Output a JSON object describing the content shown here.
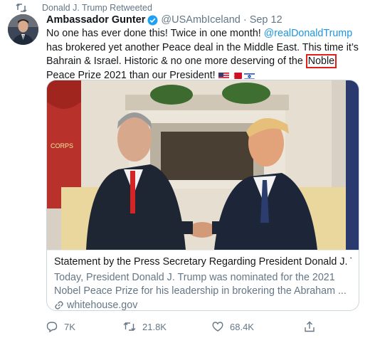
{
  "retweet": {
    "label": "Donald J. Trump Retweeted"
  },
  "author": {
    "name": "Ambassador Gunter",
    "handle": "@USAmbIceland",
    "separator": "·",
    "time": "Sep 12"
  },
  "tweet": {
    "part1": "No one has ever done this! Twice in one month! ",
    "mention": "@realDonaldTrump",
    "part2": " has brokered yet another Peace deal in the Middle East. This time it’s Bahrain & Israel. Historic & no one more deserving of the ",
    "highlighted_word": "Noble",
    "part3": " Peace Prize 2021 than our President! ",
    "flags": [
      "us-flag",
      "bahrain-flag",
      "israel-flag"
    ]
  },
  "card": {
    "title": "Statement by the Press Secretary Regarding President Donald J. T...",
    "description": "Today, President Donald J. Trump was nominated for the 2021 Nobel Peace Prize for his leadership in brokering the Abraham ...",
    "domain": "whitehouse.gov"
  },
  "actions": {
    "replies": "7K",
    "retweets": "21.8K",
    "likes": "68.4K"
  },
  "colors": {
    "link": "#1b95e0",
    "secondary_text": "#657786",
    "highlight_box": "#e0201b",
    "verified": "#1da1f2"
  }
}
